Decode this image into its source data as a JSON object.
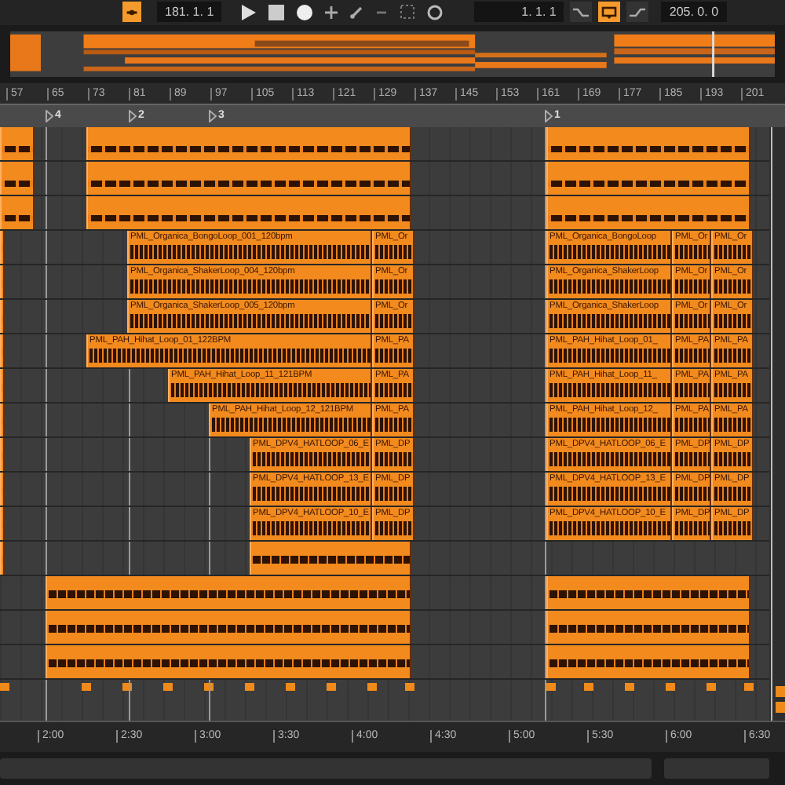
{
  "transport": [
    {
      "kind": "follow",
      "on": true
    },
    {
      "kind": "field",
      "text": "181. 1. 1"
    },
    {
      "kind": "play"
    },
    {
      "kind": "stop"
    },
    {
      "kind": "record"
    },
    {
      "kind": "add"
    },
    {
      "kind": "draw"
    },
    {
      "kind": "minus"
    },
    {
      "kind": "dotted"
    },
    {
      "kind": "circle"
    },
    {
      "kind": "field",
      "text": "1. 1. 1"
    },
    {
      "kind": "punch_in",
      "on": false
    },
    {
      "kind": "loop",
      "on": true
    },
    {
      "kind": "punch_out",
      "on": false
    },
    {
      "kind": "field",
      "text": "205. 0. 0"
    }
  ],
  "ruler": [
    "57",
    "65",
    "73",
    "81",
    "89",
    "97",
    "105",
    "113",
    "121",
    "129",
    "137",
    "145",
    "153",
    "161",
    "169",
    "177",
    "185",
    "193",
    "201"
  ],
  "locators": [
    {
      "label": "4"
    },
    {
      "label": "2"
    },
    {
      "label": "3"
    },
    {
      "label": "1"
    }
  ],
  "tracks": [
    {
      "clips": [
        {
          "kind": "audio"
        },
        {
          "kind": "audio"
        },
        {
          "kind": "audio"
        }
      ]
    },
    {
      "clips": [
        {
          "kind": "audio"
        },
        {
          "kind": "audio"
        },
        {
          "kind": "audio"
        }
      ]
    },
    {
      "clips": [
        {
          "kind": "audio"
        },
        {
          "kind": "audio"
        },
        {
          "kind": "audio"
        }
      ]
    },
    {
      "clips": [
        {
          "kind": "audio"
        },
        {
          "kind": "audio",
          "label": "PML_Organica_BongoLoop_001_120bpm"
        },
        {
          "kind": "audio",
          "label": "PML_Or"
        },
        {
          "kind": "audio",
          "label": "PML_Organica_BongoLoop"
        },
        {
          "kind": "audio",
          "label": "PML_Or"
        },
        {
          "kind": "audio",
          "label": "PML_Or"
        }
      ]
    },
    {
      "clips": [
        {
          "kind": "audio"
        },
        {
          "kind": "audio",
          "label": "PML_Organica_ShakerLoop_004_120bpm"
        },
        {
          "kind": "audio",
          "label": "PML_Or"
        },
        {
          "kind": "audio",
          "label": "PML_Organica_ShakerLoop"
        },
        {
          "kind": "audio",
          "label": "PML_Or"
        },
        {
          "kind": "audio",
          "label": "PML_Or"
        }
      ]
    },
    {
      "clips": [
        {
          "kind": "audio"
        },
        {
          "kind": "audio",
          "label": "PML_Organica_ShakerLoop_005_120bpm"
        },
        {
          "kind": "audio",
          "label": "PML_Or"
        },
        {
          "kind": "audio",
          "label": "PML_Organica_ShakerLoop"
        },
        {
          "kind": "audio",
          "label": "PML_Or"
        },
        {
          "kind": "audio",
          "label": "PML_Or"
        }
      ]
    },
    {
      "clips": [
        {
          "kind": "audio"
        },
        {
          "kind": "audio",
          "label": "PML_PAH_Hihat_Loop_01_122BPM"
        },
        {
          "kind": "audio",
          "label": "PML_PA"
        },
        {
          "kind": "audio",
          "label": "PML_PAH_Hihat_Loop_01_"
        },
        {
          "kind": "audio",
          "label": "PML_PA"
        },
        {
          "kind": "audio",
          "label": "PML_PA"
        }
      ]
    },
    {
      "clips": [
        {
          "kind": "audio"
        },
        {
          "kind": "audio",
          "label": "PML_PAH_Hihat_Loop_11_121BPM"
        },
        {
          "kind": "audio",
          "label": "PML_PA"
        },
        {
          "kind": "audio",
          "label": "PML_PAH_Hihat_Loop_11_"
        },
        {
          "kind": "audio",
          "label": "PML_PA"
        },
        {
          "kind": "audio",
          "label": "PML_PA"
        }
      ]
    },
    {
      "clips": [
        {
          "kind": "audio"
        },
        {
          "kind": "audio",
          "label": "PML_PAH_Hihat_Loop_12_121BPM"
        },
        {
          "kind": "audio",
          "label": "PML_PA"
        },
        {
          "kind": "audio",
          "label": "PML_PAH_Hihat_Loop_12_"
        },
        {
          "kind": "audio",
          "label": "PML_PA"
        },
        {
          "kind": "audio",
          "label": "PML_PA"
        }
      ]
    },
    {
      "clips": [
        {
          "kind": "audio"
        },
        {
          "kind": "audio",
          "label": "PML_DPV4_HATLOOP_06_E"
        },
        {
          "kind": "audio",
          "label": "PML_DP"
        },
        {
          "kind": "audio",
          "label": "PML_DPV4_HATLOOP_06_E"
        },
        {
          "kind": "audio",
          "label": "PML_DP"
        },
        {
          "kind": "audio",
          "label": "PML_DP"
        }
      ]
    },
    {
      "clips": [
        {
          "kind": "audio"
        },
        {
          "kind": "audio",
          "label": "PML_DPV4_HATLOOP_13_E"
        },
        {
          "kind": "audio",
          "label": "PML_DP"
        },
        {
          "kind": "audio",
          "label": "PML_DPV4_HATLOOP_13_E"
        },
        {
          "kind": "audio",
          "label": "PML_DP"
        },
        {
          "kind": "audio",
          "label": "PML_DP"
        }
      ]
    },
    {
      "clips": [
        {
          "kind": "audio"
        },
        {
          "kind": "audio",
          "label": "PML_DPV4_HATLOOP_10_E"
        },
        {
          "kind": "audio",
          "label": "PML_DP"
        },
        {
          "kind": "audio",
          "label": "PML_DPV4_HATLOOP_10_E"
        },
        {
          "kind": "audio",
          "label": "PML_DP"
        },
        {
          "kind": "audio",
          "label": "PML_DP"
        }
      ]
    },
    {
      "clips": [
        {
          "kind": "audio"
        },
        {
          "kind": "audio"
        }
      ]
    },
    {
      "clips": [
        {
          "kind": "audio"
        },
        {
          "kind": "audio"
        }
      ]
    },
    {
      "clips": [
        {
          "kind": "audio"
        },
        {
          "kind": "audio"
        }
      ]
    },
    {
      "clips": [
        {
          "kind": "audio"
        },
        {
          "kind": "audio"
        }
      ]
    }
  ],
  "time_ruler": [
    "2:00",
    "2:30",
    "3:00",
    "3:30",
    "4:00",
    "4:30",
    "5:00",
    "5:30",
    "6:00",
    "6:30"
  ]
}
